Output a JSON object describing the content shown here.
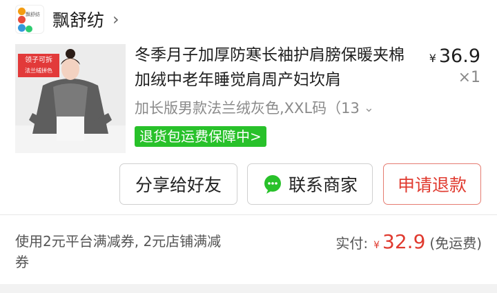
{
  "shop": {
    "name": "飘舒纺",
    "logo_text": "飘舒纺"
  },
  "product": {
    "title": "冬季月子加厚防寒长袖护肩膀保暖夹棉加绒中老年睡觉肩周产妇坎肩",
    "image_tag_main": "领子可拆",
    "image_tag_sub": "法兰绒拼色",
    "currency": "¥",
    "price": "36.9",
    "quantity": "×1",
    "sku": "加长版男款法兰绒灰色,XXL码（13",
    "badge": "退货包运费保障中>"
  },
  "actions": {
    "share": "分享给好友",
    "contact": "联系商家",
    "refund": "申请退款"
  },
  "summary": {
    "coupon": "使用2元平台满减券, 2元店铺满减券",
    "paid_label": "实付:",
    "currency": "¥",
    "paid_amount": "32.9",
    "shipping": "(免运费)"
  }
}
